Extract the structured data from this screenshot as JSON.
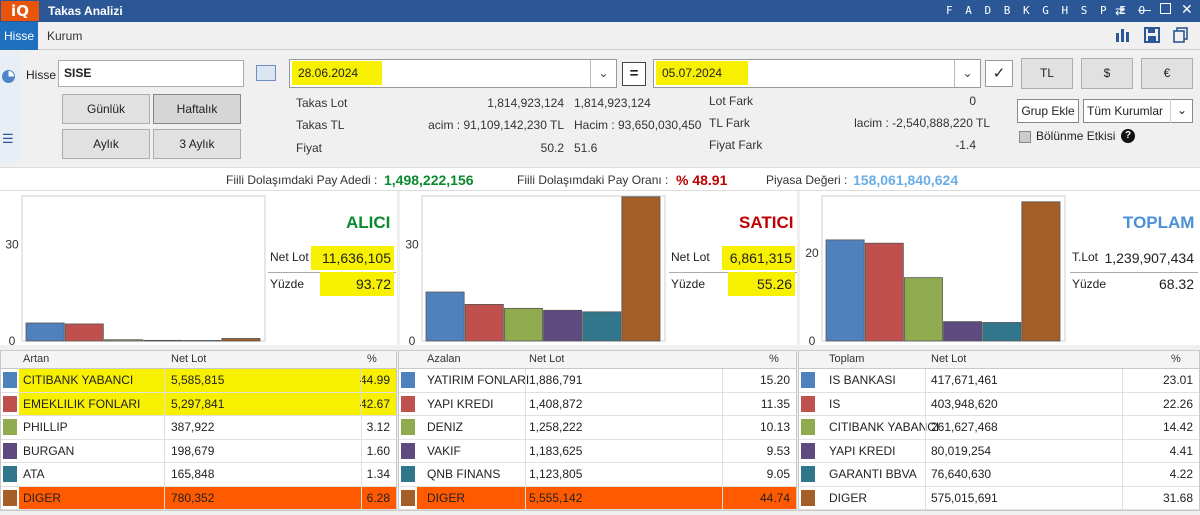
{
  "window": {
    "logo": "iQ",
    "title": "Takas Analizi",
    "hotkeys": "F A D B K G H S P E O",
    "hotkey_icon": "⇄"
  },
  "tabs": [
    {
      "label": "Hisse"
    },
    {
      "label": "Kurum"
    }
  ],
  "toolbar_icons": [
    "bar-chart-icon",
    "save-icon",
    "copy-icon"
  ],
  "form": {
    "hisse_label": "Hisse",
    "hisse_value": "SISE",
    "start_date": "28.06.2024",
    "end_date": "05.07.2024",
    "equals_label": "=",
    "check_label": "✓",
    "currency_buttons": [
      "TL",
      "$",
      "€"
    ],
    "period_buttons": [
      "Günlük",
      "Haftalık",
      "Aylık",
      "3 Aylık"
    ],
    "grup_ekle": "Grup Ekle",
    "kurum_select": "Tüm Kurumlar",
    "bolunme_label": "Bölünme Etkisi",
    "help": "?"
  },
  "info": {
    "takas_lot_label": "Takas Lot",
    "takas_lot_1": "1,814,923,124",
    "takas_lot_2": "1,814,923,124",
    "takas_tl_label": "Takas TL",
    "takas_tl_1": "acim : 91,109,142,230 TL",
    "takas_tl_2": "Hacim : 93,650,030,450 T",
    "fiyat_label": "Fiyat",
    "fiyat_1": "50.2",
    "fiyat_2": "51.6",
    "lot_fark_label": "Lot Fark",
    "lot_fark_value": "0",
    "tl_fark_label": "TL Fark",
    "tl_fark_value": "lacim : -2,540,888,220 TL",
    "fiyat_fark_label": "Fiyat Fark",
    "fiyat_fark_value": "-1.4"
  },
  "stats": {
    "fiili_adet_label": "Fiili Dolaşımdaki Pay Adedi :",
    "fiili_adet_value": "1,498,222,156",
    "fiili_oran_label": "Fiili Dolaşımdaki Pay Oranı :",
    "fiili_oran_value": "% 48.91",
    "piyasa_label": "Piyasa Değeri :",
    "piyasa_value": "158,061,840,624"
  },
  "colors": {
    "blue": "#4f81bd",
    "red": "#c0504d",
    "green": "#8faa4f",
    "purple": "#5e4a7e",
    "teal": "#31768a",
    "orange": "#a45f28",
    "alici": "#0a8a2e",
    "satici": "#c00000",
    "toplam": "#4a90d9"
  },
  "panels": [
    {
      "title": "ALICI",
      "net_label": "Net Lot",
      "net_value": "11,636,105",
      "pct_label": "Yüzde",
      "pct_value": "93.72"
    },
    {
      "title": "SATICI",
      "net_label": "Net Lot",
      "net_value": "6,861,315",
      "pct_label": "Yüzde",
      "pct_value": "55.26"
    },
    {
      "title": "TOPLAM",
      "net_label": "T.Lot",
      "net_value": "1,239,907,434",
      "pct_label": "Yüzde",
      "pct_value": "68.32"
    }
  ],
  "chart_data": [
    {
      "type": "bar",
      "title": "ALICI",
      "categories": [
        "CITIBANK YABANCI",
        "EMEKLILIK FONLARI",
        "PHILLIP",
        "BURGAN",
        "ATA",
        "DIGER"
      ],
      "values": [
        5.585815,
        5.297841,
        0.387922,
        0.198679,
        0.165848,
        0.780352
      ],
      "ylim": [
        0,
        45
      ],
      "yticks": [
        0,
        30
      ],
      "ytick_labels": [
        "0",
        "30"
      ]
    },
    {
      "type": "bar",
      "title": "SATICI",
      "categories": [
        "YATIRIM FONLARI",
        "YAPI KREDI",
        "DENIZ",
        "VAKIF",
        "QNB FINANS",
        "DIGER"
      ],
      "values": [
        15.2,
        11.35,
        10.13,
        9.53,
        9.05,
        44.74
      ],
      "ylim": [
        0,
        45
      ],
      "yticks": [
        0,
        30
      ],
      "ytick_labels": [
        "0",
        "30"
      ]
    },
    {
      "type": "bar",
      "title": "TOPLAM",
      "categories": [
        "IS BANKASI",
        "IS",
        "CITIBANK YABANCI",
        "YAPI KREDI",
        "GARANTI BBVA",
        "DIGER"
      ],
      "values": [
        23.01,
        22.26,
        14.42,
        4.41,
        4.22,
        31.68
      ],
      "ylim": [
        0,
        33
      ],
      "yticks": [
        0,
        20
      ],
      "ytick_labels": [
        "0",
        "20"
      ]
    }
  ],
  "tables": [
    {
      "headers": [
        "Artan",
        "Net Lot",
        "%"
      ],
      "rows": [
        {
          "name": "CITIBANK YABANCI",
          "lot": "5,585,815",
          "pct": "44.99"
        },
        {
          "name": "EMEKLILIK FONLARI",
          "lot": "5,297,841",
          "pct": "42.67"
        },
        {
          "name": "PHILLIP",
          "lot": "387,922",
          "pct": "3.12"
        },
        {
          "name": "BURGAN",
          "lot": "198,679",
          "pct": "1.60"
        },
        {
          "name": "ATA",
          "lot": "165,848",
          "pct": "1.34"
        },
        {
          "name": "DIGER",
          "lot": "780,352",
          "pct": "6.28"
        }
      ]
    },
    {
      "headers": [
        "Azalan",
        "Net Lot",
        "%"
      ],
      "rows": [
        {
          "name": "YATIRIM FONLARI",
          "lot": "1,886,791",
          "pct": "15.20"
        },
        {
          "name": "YAPI KREDI",
          "lot": "1,408,872",
          "pct": "11.35"
        },
        {
          "name": "DENIZ",
          "lot": "1,258,222",
          "pct": "10.13"
        },
        {
          "name": "VAKIF",
          "lot": "1,183,625",
          "pct": "9.53"
        },
        {
          "name": "QNB FINANS",
          "lot": "1,123,805",
          "pct": "9.05"
        },
        {
          "name": "DIGER",
          "lot": "5,555,142",
          "pct": "44.74"
        }
      ]
    },
    {
      "headers": [
        "Toplam",
        "Net Lot",
        "%"
      ],
      "rows": [
        {
          "name": "IS BANKASI",
          "lot": "417,671,461",
          "pct": "23.01"
        },
        {
          "name": "IS",
          "lot": "403,948,620",
          "pct": "22.26"
        },
        {
          "name": "CITIBANK YABANCI",
          "lot": "261,627,468",
          "pct": "14.42"
        },
        {
          "name": "YAPI KREDI",
          "lot": "80,019,254",
          "pct": "4.41"
        },
        {
          "name": "GARANTI BBVA",
          "lot": "76,640,630",
          "pct": "4.22"
        },
        {
          "name": "DIGER",
          "lot": "575,015,691",
          "pct": "31.68"
        }
      ]
    }
  ]
}
